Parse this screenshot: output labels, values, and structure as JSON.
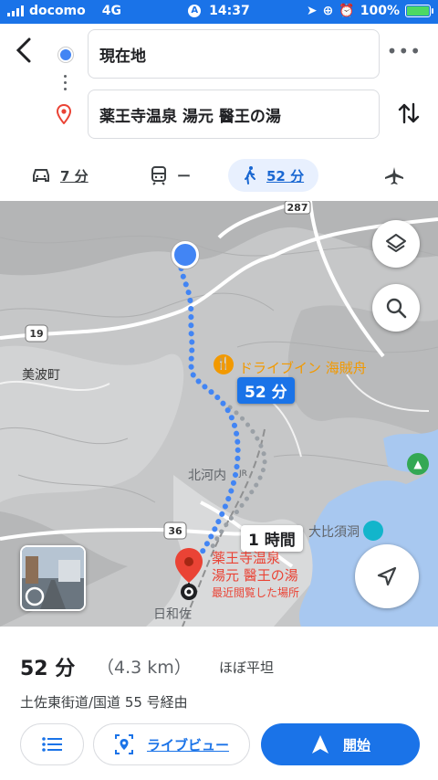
{
  "status_bar": {
    "carrier": "docomo",
    "network": "4G",
    "time": "14:37",
    "battery": "100%",
    "icons": [
      "signal-bars-icon",
      "location-arrow-icon",
      "lock-rotation-icon",
      "alarm-icon",
      "battery-charging-icon"
    ]
  },
  "header": {
    "origin": "現在地",
    "destination": "薬王寺温泉 湯元 醫王の湯"
  },
  "modes": {
    "car": "7 分",
    "transit": "ー",
    "walk": "52 分"
  },
  "map": {
    "route_badge": "52 分",
    "alt_badge": "1 時間",
    "labels": {
      "road_19": "19",
      "road_36": "36",
      "road_287": "287",
      "town": "美波町",
      "restaurant": "ドライブイン 海賊舟",
      "station1": "北河内",
      "station2": "日和佐",
      "cave": "大比須洞",
      "dest_line1": "薬王寺温泉",
      "dest_line2": "湯元 醫王の湯",
      "dest_note": "最近閲覧した場所",
      "jr": "JR"
    }
  },
  "sheet": {
    "duration": "52 分",
    "distance": "（4.3 km）",
    "terrain": "ほぼ平坦",
    "via": "土佐東街道/国道 55 号経由",
    "live_view": "ライブビュー",
    "start": "開始"
  },
  "colors": {
    "accent": "#1a73e8",
    "route": "#4285f4",
    "pin": "#ea4335",
    "food": "#f29900"
  }
}
